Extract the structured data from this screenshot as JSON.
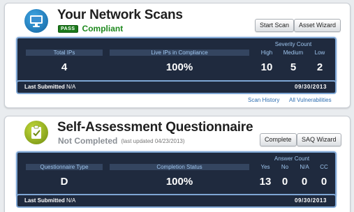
{
  "network": {
    "title": "Your Network Scans",
    "pass_badge": "PASS",
    "status": "Compliant",
    "buttons": {
      "start_scan": "Start Scan",
      "asset_wizard": "Asset Wizard"
    },
    "metrics": {
      "total_ips_label": "Total IPs",
      "total_ips_value": "4",
      "live_ips_label": "Live IPs in Compliance",
      "live_ips_value": "100%",
      "severity_title": "Severity Count",
      "severity": [
        {
          "label": "High",
          "value": "10"
        },
        {
          "label": "Medium",
          "value": "5"
        },
        {
          "label": "Low",
          "value": "2"
        }
      ]
    },
    "last_submitted_label": "Last Submitted",
    "last_submitted_value": "N/A",
    "date": "09/30/2013",
    "links": {
      "scan_history": "Scan History",
      "all_vulnerabilities": "All Vulnerabilities"
    }
  },
  "saq": {
    "title": "Self-Assessment Questionnaire",
    "status": "Not Completed",
    "updated": "(last updated 04/23/2013)",
    "buttons": {
      "complete": "Complete",
      "saq_wizard": "SAQ Wizard"
    },
    "metrics": {
      "type_label": "Questionnaire Type",
      "type_value": "D",
      "completion_label": "Completion Status",
      "completion_value": "100%",
      "answer_title": "Answer Count",
      "answers": [
        {
          "label": "Yes",
          "value": "13"
        },
        {
          "label": "No",
          "value": "0"
        },
        {
          "label": "N/A",
          "value": "0"
        },
        {
          "label": "CC",
          "value": "0"
        }
      ]
    },
    "last_submitted_label": "Last Submitted",
    "last_submitted_value": "N/A",
    "date": "09/30/2013"
  },
  "icons": {
    "network": "monitor-icon",
    "saq": "clipboard-icon"
  }
}
